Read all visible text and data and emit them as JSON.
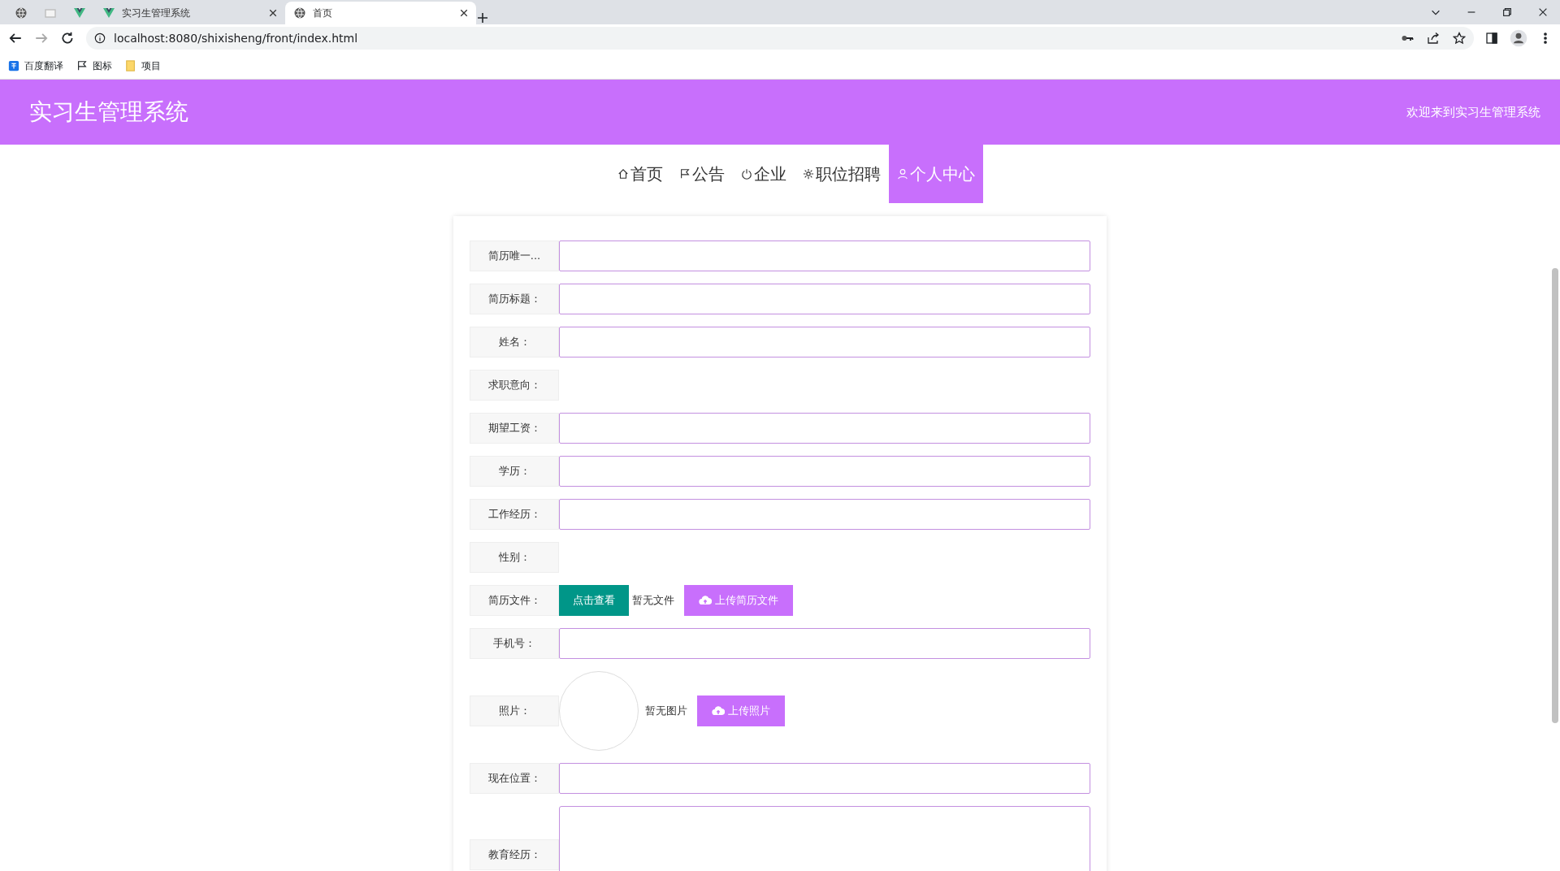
{
  "browser": {
    "tabs": [
      {
        "selected": false
      },
      {
        "selected": false
      },
      {
        "selected": false
      },
      {
        "label": "实习生管理系统",
        "selected": false
      },
      {
        "label": "首页",
        "selected": true
      }
    ],
    "url": "localhost:8080/shixisheng/front/index.html",
    "bookmarks": [
      {
        "label": "百度翻译"
      },
      {
        "label": "图标"
      },
      {
        "label": "项目"
      }
    ]
  },
  "header": {
    "title": "实习生管理系统",
    "welcome": "欢迎来到实习生管理系统"
  },
  "nav": [
    {
      "label": "首页",
      "selected": false
    },
    {
      "label": "公告",
      "selected": false
    },
    {
      "label": "企业",
      "selected": false
    },
    {
      "label": "职位招聘",
      "selected": false
    },
    {
      "label": "个人中心",
      "selected": true
    }
  ],
  "form": [
    {
      "kind": "input",
      "label": "简历唯一..."
    },
    {
      "kind": "input",
      "label": "简历标题："
    },
    {
      "kind": "input",
      "label": "姓名："
    },
    {
      "kind": "empty",
      "label": "求职意向："
    },
    {
      "kind": "input",
      "label": "期望工资："
    },
    {
      "kind": "input",
      "label": "学历："
    },
    {
      "kind": "input",
      "label": "工作经历："
    },
    {
      "kind": "empty",
      "label": "性别："
    },
    {
      "kind": "file",
      "label": "简历文件：",
      "view_button": "点击查看",
      "status": "暂无文件",
      "upload_button": "上传简历文件"
    },
    {
      "kind": "input",
      "label": "手机号："
    },
    {
      "kind": "image",
      "label": "照片：",
      "status": "暂无图片",
      "upload_button": "上传照片"
    },
    {
      "kind": "input",
      "label": "现在位置："
    },
    {
      "kind": "textarea",
      "label": "教育经历："
    }
  ]
}
